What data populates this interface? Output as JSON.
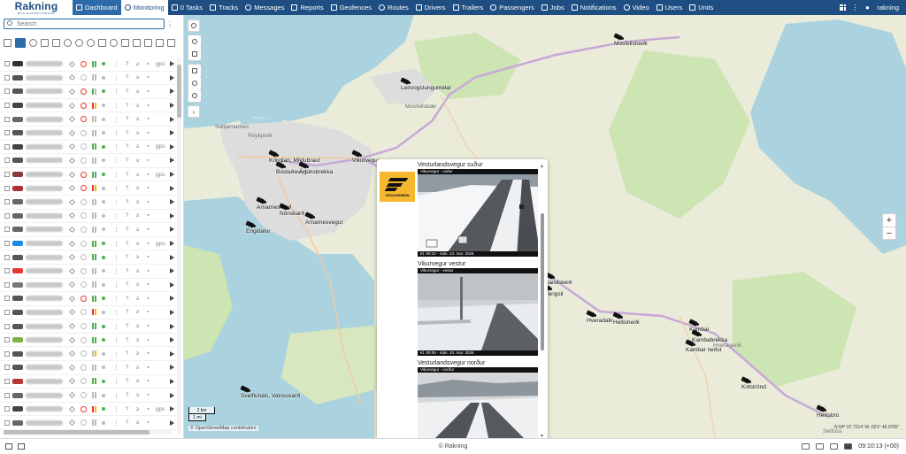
{
  "app": {
    "logo_text": "Rakning",
    "logo_subtext": "BÍLA FLOTASTJÓRNUN",
    "username": "rakning"
  },
  "nav": [
    {
      "label": "Dashboard",
      "icon": "chart-icon",
      "state": "active"
    },
    {
      "label": "Monitoring",
      "icon": "globe-icon",
      "state": "selected"
    },
    {
      "label": "0  Tasks",
      "icon": "check-circle-icon",
      "state": ""
    },
    {
      "label": "Tracks",
      "icon": "flag-icon",
      "state": ""
    },
    {
      "label": "Messages",
      "icon": "envelope-icon",
      "state": ""
    },
    {
      "label": "Reports",
      "icon": "report-icon",
      "state": ""
    },
    {
      "label": "Geofences",
      "icon": "geofence-icon",
      "state": ""
    },
    {
      "label": "Routes",
      "icon": "route-icon",
      "state": ""
    },
    {
      "label": "Drivers",
      "icon": "driver-icon",
      "state": ""
    },
    {
      "label": "Trailers",
      "icon": "trailer-icon",
      "state": ""
    },
    {
      "label": "Passengers",
      "icon": "passenger-icon",
      "state": ""
    },
    {
      "label": "Jobs",
      "icon": "jobs-icon",
      "state": ""
    },
    {
      "label": "Notifications",
      "icon": "bell-icon",
      "state": ""
    },
    {
      "label": "Video",
      "icon": "video-icon",
      "state": ""
    },
    {
      "label": "Users",
      "icon": "user-icon",
      "state": ""
    },
    {
      "label": "Units",
      "icon": "car-icon",
      "state": ""
    }
  ],
  "sidebar": {
    "search_placeholder": "Search",
    "units": [
      {
        "car": "#333",
        "block": "red",
        "batt": [
          "#4caf50",
          "#4caf50"
        ],
        "dot": "#4caf50",
        "speed": "gps"
      },
      {
        "car": "#555",
        "block": "grey",
        "batt": [
          "#bbb",
          "#bbb"
        ],
        "dot": "#bbb",
        "speed": ""
      },
      {
        "car": "#555",
        "block": "red",
        "batt": [
          "#4caf50",
          "#bbb"
        ],
        "dot": "#4caf50",
        "speed": ""
      },
      {
        "car": "#444",
        "block": "red",
        "batt": [
          "#e53935",
          "#ffb300"
        ],
        "dot": "#bbb",
        "speed": ""
      },
      {
        "car": "#666",
        "block": "red",
        "batt": [
          "#bbb",
          "#bbb"
        ],
        "dot": "#bbb",
        "speed": ""
      },
      {
        "car": "#555",
        "block": "grey",
        "batt": [
          "#bbb",
          "#bbb"
        ],
        "dot": "#bbb",
        "speed": ""
      },
      {
        "car": "#444",
        "block": "grey",
        "batt": [
          "#4caf50",
          "#4caf50"
        ],
        "dot": "#4caf50",
        "speed": "gps"
      },
      {
        "car": "#555",
        "block": "grey",
        "batt": [
          "#bbb",
          "#bbb"
        ],
        "dot": "#bbb",
        "speed": ""
      },
      {
        "car": "#8b3a3a",
        "block": "red",
        "batt": [
          "#4caf50",
          "#4caf50"
        ],
        "dot": "#4caf50",
        "speed": "gps"
      },
      {
        "car": "#a33",
        "block": "red",
        "batt": [
          "#e53935",
          "#ffb300"
        ],
        "dot": "#bbb",
        "speed": ""
      },
      {
        "car": "#666",
        "block": "grey",
        "batt": [
          "#bbb",
          "#bbb"
        ],
        "dot": "#bbb",
        "speed": ""
      },
      {
        "car": "#666",
        "block": "grey",
        "batt": [
          "#bbb",
          "#bbb"
        ],
        "dot": "#bbb",
        "speed": ""
      },
      {
        "car": "#666",
        "block": "grey",
        "batt": [
          "#bbb",
          "#bbb"
        ],
        "dot": "#bbb",
        "speed": ""
      },
      {
        "car": "#1e88e5",
        "block": "grey",
        "batt": [
          "#4caf50",
          "#4caf50"
        ],
        "dot": "#4caf50",
        "speed": "gps"
      },
      {
        "car": "#555",
        "block": "grey",
        "batt": [
          "#4caf50",
          "#4caf50"
        ],
        "dot": "#4caf50",
        "speed": ""
      },
      {
        "car": "#e53935",
        "block": "grey",
        "batt": [
          "#bbb",
          "#bbb"
        ],
        "dot": "#bbb",
        "speed": ""
      },
      {
        "car": "#777",
        "block": "grey",
        "batt": [
          "#bbb",
          "#bbb"
        ],
        "dot": "#bbb",
        "speed": ""
      },
      {
        "car": "#555",
        "block": "red",
        "batt": [
          "#4caf50",
          "#4caf50"
        ],
        "dot": "#4caf50",
        "speed": ""
      },
      {
        "car": "#555",
        "block": "grey",
        "batt": [
          "#e53935",
          "#ffb300"
        ],
        "dot": "#bbb",
        "speed": ""
      },
      {
        "car": "#555",
        "block": "grey",
        "batt": [
          "#4caf50",
          "#4caf50"
        ],
        "dot": "#4caf50",
        "speed": ""
      },
      {
        "car": "#7cb342",
        "block": "grey",
        "batt": [
          "#4caf50",
          "#4caf50"
        ],
        "dot": "#4caf50",
        "speed": ""
      },
      {
        "car": "#555",
        "block": "grey",
        "batt": [
          "#bbb",
          "#ffb300"
        ],
        "dot": "#bbb",
        "speed": ""
      },
      {
        "car": "#555",
        "block": "grey",
        "batt": [
          "#bbb",
          "#bbb"
        ],
        "dot": "#bbb",
        "speed": ""
      },
      {
        "car": "#b33",
        "block": "grey",
        "batt": [
          "#4caf50",
          "#4caf50"
        ],
        "dot": "#4caf50",
        "speed": ""
      },
      {
        "car": "#666",
        "block": "grey",
        "batt": [
          "#bbb",
          "#bbb"
        ],
        "dot": "#bbb",
        "speed": ""
      },
      {
        "car": "#444",
        "block": "red",
        "batt": [
          "#e53935",
          "#ffb300"
        ],
        "dot": "#4caf50",
        "speed": "gps"
      },
      {
        "car": "#666",
        "block": "grey",
        "batt": [
          "#bbb",
          "#bbb"
        ],
        "dot": "#bbb",
        "speed": ""
      }
    ]
  },
  "map": {
    "cameras": [
      {
        "label": "Mosfellsheiði"
      },
      {
        "label": "Leirvogstungumelar"
      },
      {
        "label": "Kringlan, Miklubraut"
      },
      {
        "label": "Bústaðavegur"
      },
      {
        "label": "Ártúnsbrekka"
      },
      {
        "label": "Vikurvegur"
      },
      {
        "label": "Arnarneshæð"
      },
      {
        "label": "Nónskarð"
      },
      {
        "label": "Arnarnesvegur"
      },
      {
        "label": "Engidalur"
      },
      {
        "label": "Sandskeið"
      },
      {
        "label": "Þrengsli"
      },
      {
        "label": "Hveradalir"
      },
      {
        "label": "Hellisheiði"
      },
      {
        "label": "Kambar"
      },
      {
        "label": "Kambabrekka"
      },
      {
        "label": "Kambar neðst"
      },
      {
        "label": "Kotströnd"
      },
      {
        "label": "Hellisbrú"
      },
      {
        "label": "Sveifluháls, Vatnsskarð"
      }
    ],
    "places": [
      {
        "label": "Reykjavík"
      },
      {
        "label": "Seltjarnarnes"
      },
      {
        "label": "Mosfellsbær"
      },
      {
        "label": "Hveragerði"
      },
      {
        "label": "Selfoss"
      }
    ],
    "scale_km": "2 km",
    "scale_mi": "1 mi",
    "attribution": "© OpenStreetMap contributors",
    "coords": "N 64° 07.7214' W -021° 45.0792'"
  },
  "popup": {
    "logo_name": "VEGAGERÐIN",
    "feeds": [
      {
        "title": "Vesturlandsvegur suður",
        "tag": "Vikurvegur - suður",
        "timestamp": "Kl. 00:10 - mán. 23. mar. 2026"
      },
      {
        "title": "Vikurvegur vestur",
        "tag": "Vikurvegur - vestur",
        "timestamp": "Kl. 00:09 - mán. 23. mar. 2026"
      },
      {
        "title": "Vesturlandsvegur norður",
        "tag": "Vikurvegur - norður",
        "timestamp": ""
      }
    ]
  },
  "bottom": {
    "copyright": "© Rakning",
    "clock": "09:10:13 (+00)"
  }
}
